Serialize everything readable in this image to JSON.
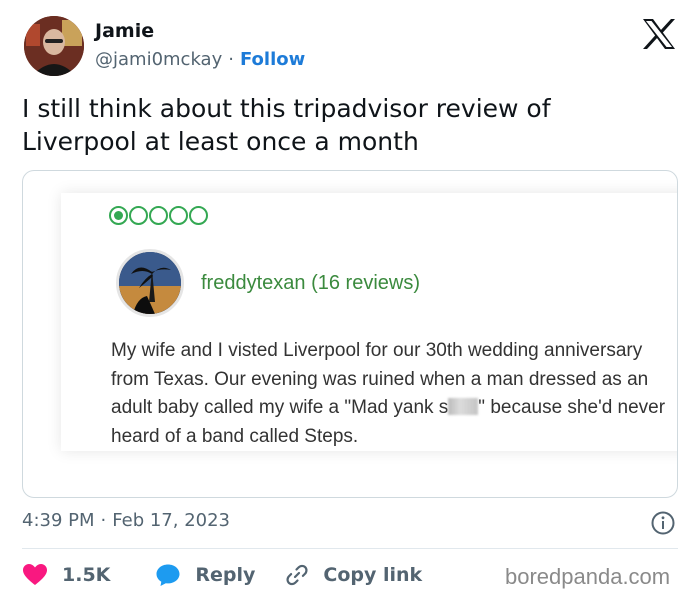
{
  "author": {
    "name": "Jamie",
    "handle": "@jami0mckay",
    "separator": "·",
    "follow_label": "Follow"
  },
  "icons": {
    "platform_logo": "x-logo-icon",
    "info": "info-icon",
    "like": "heart-icon",
    "reply": "speech-bubble-icon",
    "copy_link": "link-icon"
  },
  "tweet": {
    "text": "I still think about this tripadvisor review of Liverpool at least once a month"
  },
  "review": {
    "rating_filled": 1,
    "rating_max": 5,
    "reviewer": "freddytexan (16 reviews)",
    "body_start": "My wife and I visted Liverpool for our 30th wedding anniversary from Texas. Our evening was ruined when a man dressed as an adult baby called my wife a \"Mad yank s",
    "body_end": "\" because she'd never heard of a band called Steps."
  },
  "meta": {
    "time": "4:39 PM",
    "separator": "·",
    "date": "Feb 17, 2023"
  },
  "actions": {
    "likes": "1.5K",
    "reply_label": "Reply",
    "copy_label": "Copy link"
  },
  "watermark": "boredpanda.com",
  "colors": {
    "link": "#1d7bd8",
    "like": "#f91880",
    "reply": "#1d9bf0",
    "rating": "#34a853",
    "reviewer": "#3b8a3e"
  }
}
